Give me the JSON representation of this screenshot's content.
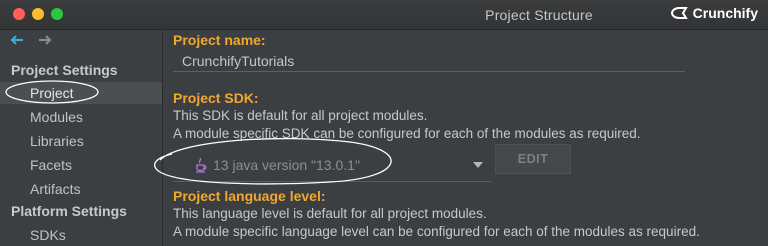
{
  "window": {
    "title": "Project Structure",
    "brand": "Crunchify"
  },
  "icons": {
    "back": "arrow-left-icon",
    "forward": "arrow-right-icon",
    "java": "java-cup-icon",
    "dropdown": "chevron-down-icon"
  },
  "colors": {
    "accent_orange": "#f0a732",
    "back_arrow": "#3fa8d5",
    "selection": "#4b4e52"
  },
  "sidebar": {
    "project_settings": "Project Settings",
    "items": [
      {
        "label": "Project",
        "selected": true
      },
      {
        "label": "Modules"
      },
      {
        "label": "Libraries"
      },
      {
        "label": "Facets"
      },
      {
        "label": "Artifacts"
      }
    ],
    "platform_settings": "Platform Settings",
    "platform_items": [
      {
        "label": "SDKs"
      }
    ]
  },
  "main": {
    "project_name_label": "Project name:",
    "project_name_value": "CrunchifyTutorials",
    "project_sdk_label": "Project SDK:",
    "sdk_desc_1": "This SDK is default for all project modules.",
    "sdk_desc_2": "A module specific SDK can be configured for each of the modules as required.",
    "sdk_selected": "13 java version \"13.0.1\"",
    "edit_button": "EDIT",
    "language_level_label": "Project language level:",
    "lang_desc_1": "This language level is default for all project modules.",
    "lang_desc_2": "A module specific language level can be configured for each of the modules as required."
  }
}
